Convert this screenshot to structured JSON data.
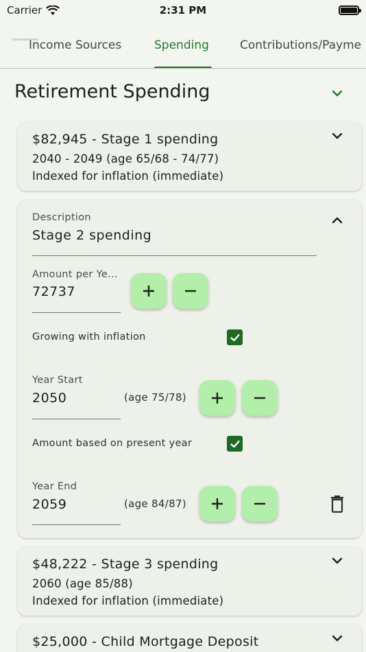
{
  "status_bar": {
    "carrier": "Carrier",
    "time": "2:31 PM"
  },
  "tabs": [
    {
      "label": "Income Sources"
    },
    {
      "label": "Spending"
    },
    {
      "label": "Contributions/Payme"
    }
  ],
  "section": {
    "title": "Retirement Spending"
  },
  "cards": [
    {
      "title": "$82,945 - Stage 1 spending",
      "line1": "2040 - 2049 (age 65/68 - 74/77)",
      "line2": "Indexed for inflation (immediate)"
    },
    {
      "description_label": "Description",
      "description_value": "Stage 2 spending",
      "amount_label": "Amount per Ye...",
      "amount_value": "72737",
      "growing_label": "Growing with inflation",
      "year_start_label": "Year Start",
      "year_start_value": "2050",
      "year_start_age": "(age 75/78)",
      "present_year_label": "Amount based on present year",
      "year_end_label": "Year End",
      "year_end_value": "2059",
      "year_end_age": "(age 84/87)"
    },
    {
      "title": "$48,222 - Stage 3 spending",
      "line1": "2060 (age 85/88)",
      "line2": "Indexed for inflation (immediate)"
    },
    {
      "title": "$25,000 - Child Mortgage Deposit"
    }
  ],
  "colors": {
    "accent": "#1f7a2a",
    "button_bg": "#b3eeaa",
    "card_bg": "#eef1ea"
  }
}
